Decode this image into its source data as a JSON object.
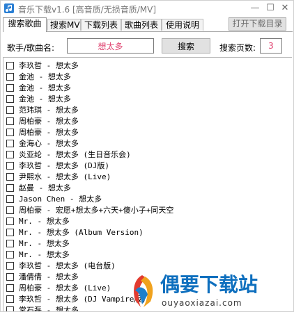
{
  "window": {
    "title": "音乐下载v1.6 [高音质/无损音质/MV]",
    "minimize": "—",
    "maximize": "☐",
    "close": "✕"
  },
  "tabs": [
    {
      "label": "搜索歌曲",
      "active": true
    },
    {
      "label": "搜索MV",
      "active": false
    },
    {
      "label": "下载列表",
      "active": false
    },
    {
      "label": "歌曲列表",
      "active": false
    },
    {
      "label": "使用说明",
      "active": false
    }
  ],
  "open_dir_label": "打开下载目录",
  "search": {
    "label": "歌手/歌曲名:",
    "value": "想太多",
    "button_label": "搜索",
    "pages_label": "搜索页数:",
    "pages_value": "3"
  },
  "results": [
    "李玖哲 - 想太多",
    "金池 - 想太多",
    "金池 - 想太多",
    "金池 - 想太多",
    "范玮琪 - 想太多",
    "周柏豪 - 想太多",
    "周柏豪 - 想太多",
    "金海心 - 想太多",
    "炎亚纶 - 想太多 (生日音乐会)",
    "李玖哲 - 想太多 (DJ版)",
    "尹熙水 - 想太多 (Live)",
    "赵曼 - 想太多",
    "Jason Chen - 想太多",
    "周柏豪 - 宏愿+想太多+六天+傻小子+同天空",
    "Mr. - 想太多",
    "Mr. - 想太多 (Album Version)",
    "Mr. - 想太多",
    "Mr. - 想太多",
    "李玖哲 - 想太多 (电台版)",
    "潘倩倩 - 想太多",
    "周柏豪 - 想太多 (Live)",
    "李玖哲 - 想太多 (DJ Vampire版)",
    "常石磊 - 想太多"
  ],
  "watermark": {
    "text": "偶要下载站",
    "url": "ouyaoxiazai.com"
  },
  "colors": {
    "accent_text": "#e0426f",
    "watermark_blue": "#0e6fbe"
  }
}
